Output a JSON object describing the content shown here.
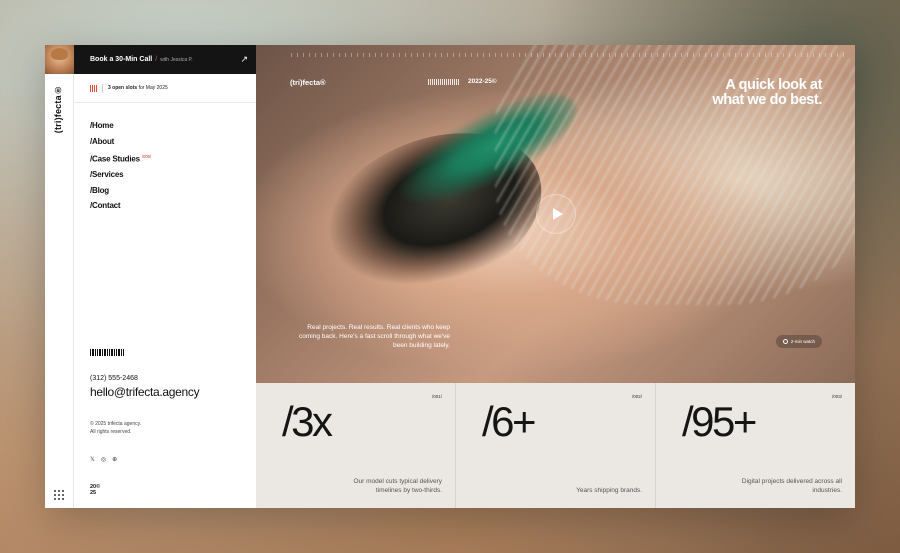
{
  "sidebar": {
    "vertical_logo": "(tri)fecta®",
    "book_call": {
      "title": "Book a 30-Min Call",
      "slash": "/",
      "with": "with Jessica P."
    },
    "slots": {
      "count_text": "3 open slots",
      "for_text": "for May 2025"
    },
    "nav": [
      {
        "label": "/Home"
      },
      {
        "label": "/About"
      },
      {
        "label": "/Case Studies",
        "badge": "/009/"
      },
      {
        "label": "/Services"
      },
      {
        "label": "/Blog"
      },
      {
        "label": "/Contact"
      }
    ],
    "phone": "(312) 555-2468",
    "email": "hello@trifecta.agency",
    "copyright_line1": "© 2025 trifecta agency.",
    "copyright_line2": "All rights reserved.",
    "year_top": "20©",
    "year_bottom": "25"
  },
  "hero": {
    "logo": "(tri)fecta®",
    "year": "2022-25©",
    "title_line1": "A quick look at",
    "title_line2": "what we do best.",
    "description": "Real projects. Real results. Real clients who keep coming back. Here's a fast scroll through what we've been building lately.",
    "watch_label": "2-min watch"
  },
  "stats": [
    {
      "index": "/001/",
      "value": "/3x",
      "desc": "Our model cuts typical delivery timelines by two-thirds."
    },
    {
      "index": "/002/",
      "value": "/6+",
      "desc": "Years shipping brands."
    },
    {
      "index": "/003/",
      "value": "/95+",
      "desc": "Digital projects delivered across all industries."
    }
  ],
  "colors": {
    "accent": "#e34b2f",
    "dark": "#141414",
    "stats_bg": "#ebe8e3"
  }
}
